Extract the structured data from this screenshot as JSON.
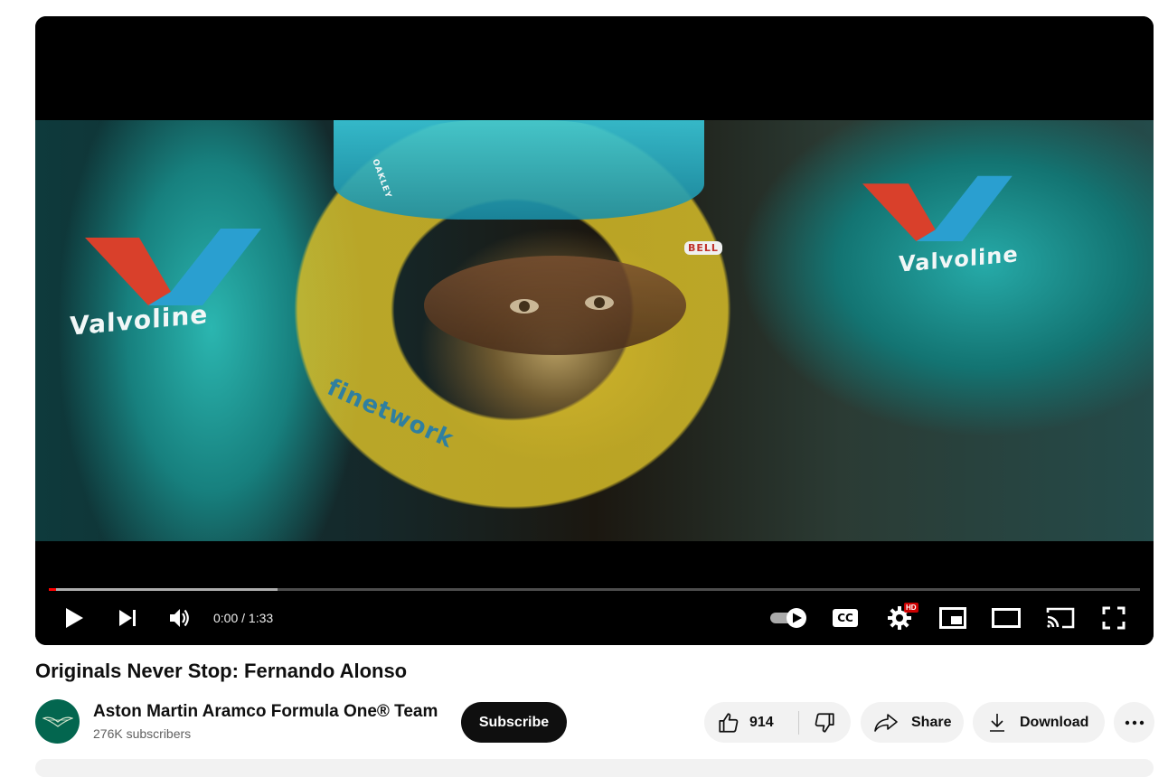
{
  "video": {
    "overlay_texts": [
      "Valvoline",
      "Valvoline",
      "finetwork",
      "BELL",
      "OAKLEY"
    ],
    "progress": {
      "played_fraction": 0.007,
      "buffered_fraction": 0.21
    },
    "time_display": "0:00 / 1:33",
    "settings_badge": "HD",
    "controls": {
      "play_icon": "play-icon",
      "next_icon": "next-icon",
      "volume_icon": "volume-icon",
      "autoplay_icon": "autoplay-toggle-icon",
      "cc_label": "CC",
      "settings_icon": "gear-icon",
      "miniplayer_icon": "miniplayer-icon",
      "theater_icon": "theater-icon",
      "cast_icon": "cast-icon",
      "fullscreen_icon": "fullscreen-icon"
    }
  },
  "title": "Originals Never Stop: Fernando Alonso",
  "channel": {
    "name": "Aston Martin Aramco Formula One® Team",
    "subscribers": "276K subscribers",
    "avatar_icon": "aston-martin-wings-logo"
  },
  "actions": {
    "subscribe_label": "Subscribe",
    "like_count": "914",
    "share_label": "Share",
    "download_label": "Download",
    "more_icon": "more-icon"
  },
  "colors": {
    "progress_played": "#ff0000",
    "subscribe_bg": "#0f0f0f",
    "pill_bg": "#f2f2f2",
    "settings_badge": "#cc0000"
  }
}
